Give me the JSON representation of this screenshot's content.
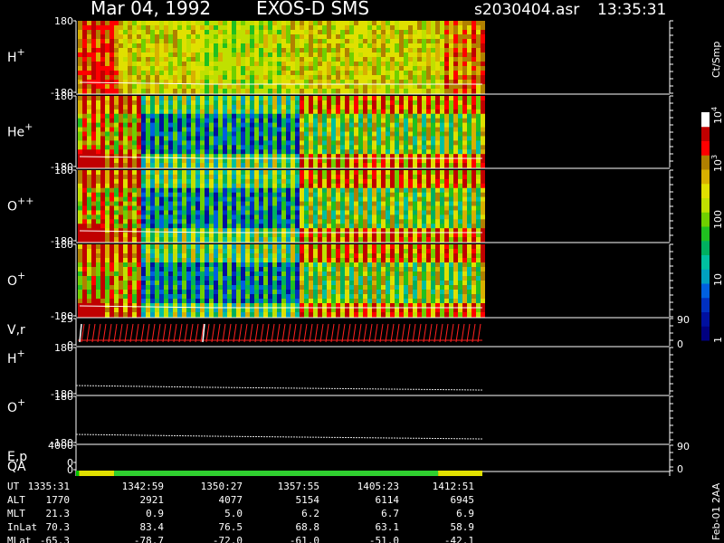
{
  "header": {
    "title_left": "Mar 04, 1992",
    "title_mid": "EXOS-D SMS",
    "title_file": "s2030404.asr",
    "title_time": "13:35:31"
  },
  "colorbar": {
    "unit": "Ct/Smp",
    "ticks": [
      {
        "label": "1",
        "frac": 0.02
      },
      {
        "label": "10",
        "frac": 0.27
      },
      {
        "label": "100",
        "frac": 0.52
      },
      {
        "label": "10",
        "sup": "3",
        "frac": 0.77
      },
      {
        "label": "10",
        "sup": "4",
        "frac": 0.98
      }
    ],
    "colors": [
      "#000080",
      "#0010a0",
      "#0030c0",
      "#0060e0",
      "#00a0c0",
      "#00c0a0",
      "#00b060",
      "#20c020",
      "#70d000",
      "#c0e000",
      "#e0e000",
      "#d8b000",
      "#b08000",
      "#ff0000",
      "#c00000",
      "#ffffff"
    ]
  },
  "side_label": "Feb-01 2AA",
  "chart_data": [
    {
      "type": "heatmap",
      "panel": "H+",
      "ylabel": "H",
      "ylabel_sup": "+",
      "ylim": [
        -180,
        180
      ],
      "yticks": [
        "180",
        "-180"
      ]
    },
    {
      "type": "heatmap",
      "panel": "He+",
      "ylabel": "He",
      "ylabel_sup": "+",
      "ylim": [
        -180,
        180
      ],
      "yticks": [
        "180",
        "-180"
      ]
    },
    {
      "type": "heatmap",
      "panel": "O++",
      "ylabel": "O",
      "ylabel_sup": "++",
      "ylim": [
        -180,
        180
      ],
      "yticks": [
        "180",
        "-180"
      ]
    },
    {
      "type": "heatmap",
      "panel": "O+",
      "ylabel": "O",
      "ylabel_sup": "+",
      "ylim": [
        -180,
        180
      ],
      "yticks": [
        "180",
        "-180"
      ]
    },
    {
      "type": "line",
      "panel": "V,r",
      "ylabel": "V,r",
      "ylim": [
        0,
        25
      ],
      "yticks": [
        "25",
        "0"
      ],
      "right_ticks": [
        "90",
        "0"
      ]
    },
    {
      "type": "line",
      "panel": "H+ angle",
      "ylabel": "H",
      "ylabel_sup": "+",
      "ylim": [
        -180,
        180
      ],
      "yticks": [
        "180",
        "-180"
      ]
    },
    {
      "type": "line",
      "panel": "O+ angle",
      "ylabel": "O",
      "ylabel_sup": "+",
      "ylim": [
        -180,
        180
      ],
      "yticks": [
        "180",
        "-180"
      ]
    },
    {
      "type": "line",
      "panel": "E,p",
      "ylabel": "E,p",
      "ylim": [
        0,
        4000
      ],
      "yticks": [
        "4000",
        "0"
      ],
      "right_ticks": [
        "90",
        "0"
      ]
    },
    {
      "type": "bar",
      "panel": "QA",
      "ylabel": "QA",
      "yticks": [
        "0"
      ],
      "segments": [
        {
          "t0": 1335.5,
          "t1": 1336.1,
          "color": "#00c000"
        },
        {
          "t0": 1336.1,
          "t1": 1342.9,
          "color": "#e0e000"
        },
        {
          "t0": 1342.9,
          "t1": 1405.9,
          "color": "#30d030"
        },
        {
          "t0": 1405.9,
          "t1": 1414.5,
          "color": "#e0e000"
        }
      ]
    }
  ],
  "table": {
    "rows": [
      {
        "name": "UT",
        "values": [
          "1335:31",
          "1342:59",
          "1350:27",
          "1357:55",
          "1405:23",
          "1412:51"
        ]
      },
      {
        "name": "ALT",
        "values": [
          "1770",
          "2921",
          "4077",
          "5154",
          "6114",
          "6945"
        ]
      },
      {
        "name": "MLT",
        "values": [
          "21.3",
          "0.9",
          "5.0",
          "6.2",
          "6.7",
          "6.9"
        ]
      },
      {
        "name": "InLat",
        "values": [
          "70.3",
          "83.4",
          "76.5",
          "68.8",
          "63.1",
          "58.9"
        ]
      },
      {
        "name": "MLat",
        "values": [
          "-65.3",
          "-78.7",
          "-72.0",
          "-61.0",
          "-51.0",
          "-42.1"
        ]
      }
    ]
  }
}
